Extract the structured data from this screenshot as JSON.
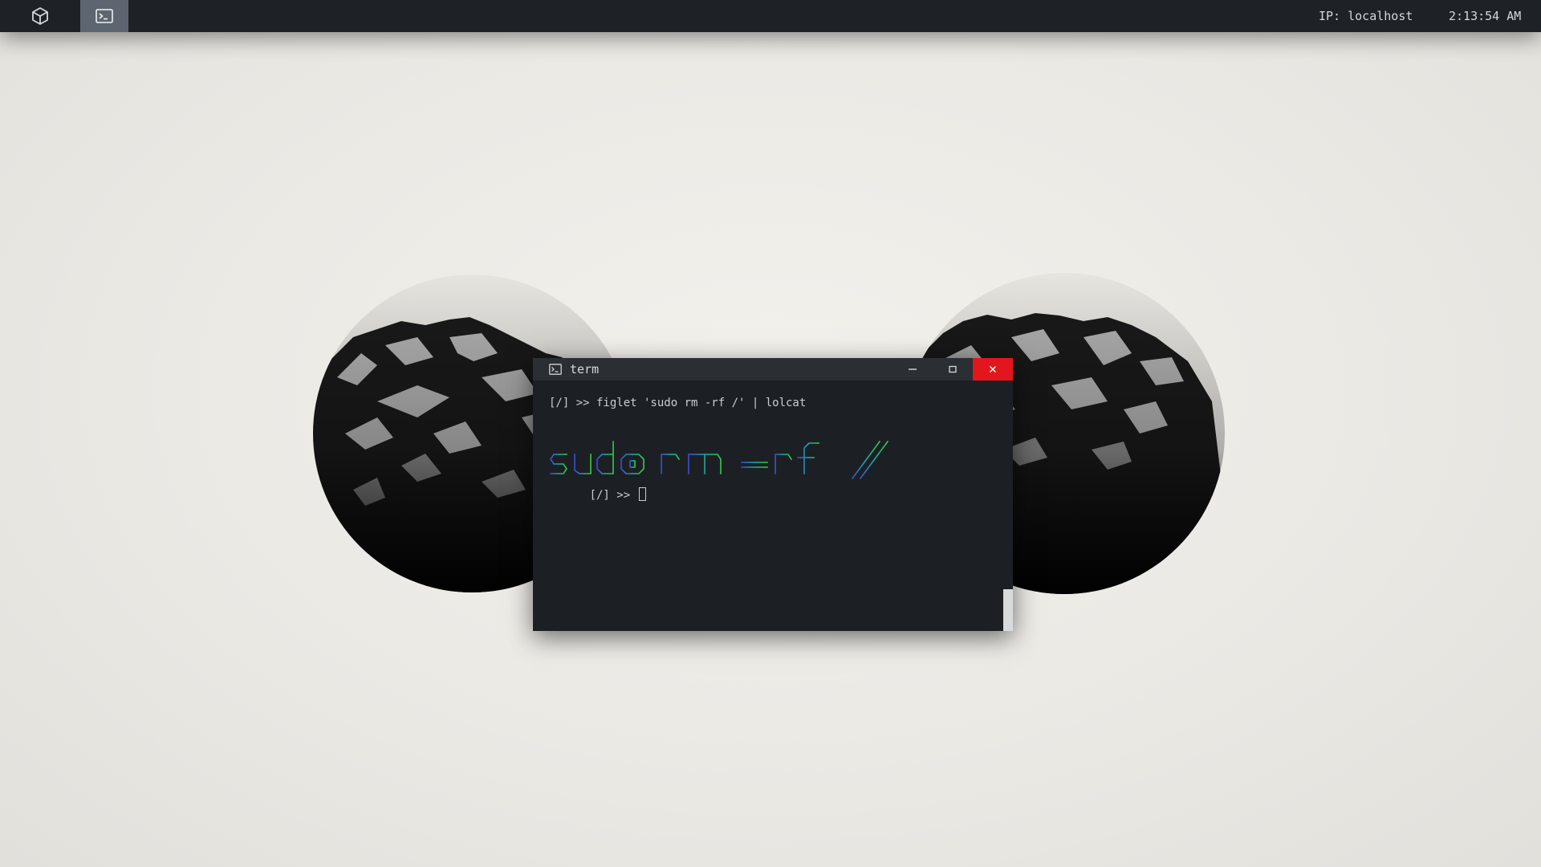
{
  "panel": {
    "launcher_icon": "cube-icon",
    "task_icon": "terminal-icon",
    "ip_text": "IP: localhost",
    "clock_text": "2:13:54 AM",
    "bg_color": "#1e2226",
    "active_task_color": "#5d6670"
  },
  "window": {
    "title": "term",
    "icon": "terminal-icon",
    "minimize_icon": "minimize-icon",
    "maximize_icon": "maximize-icon",
    "close_icon": "close-icon",
    "close_color": "#e3161d"
  },
  "terminal": {
    "command_line": "[/] >> figlet 'sudo rm -rf /' | lolcat",
    "figlet_text": "sudo rm -rf /",
    "prompt": "[/] >> ",
    "gradient_colors": [
      "#3d4fc9",
      "#2b7fc0",
      "#22a9a4",
      "#25b86a",
      "#3cc94a"
    ]
  }
}
